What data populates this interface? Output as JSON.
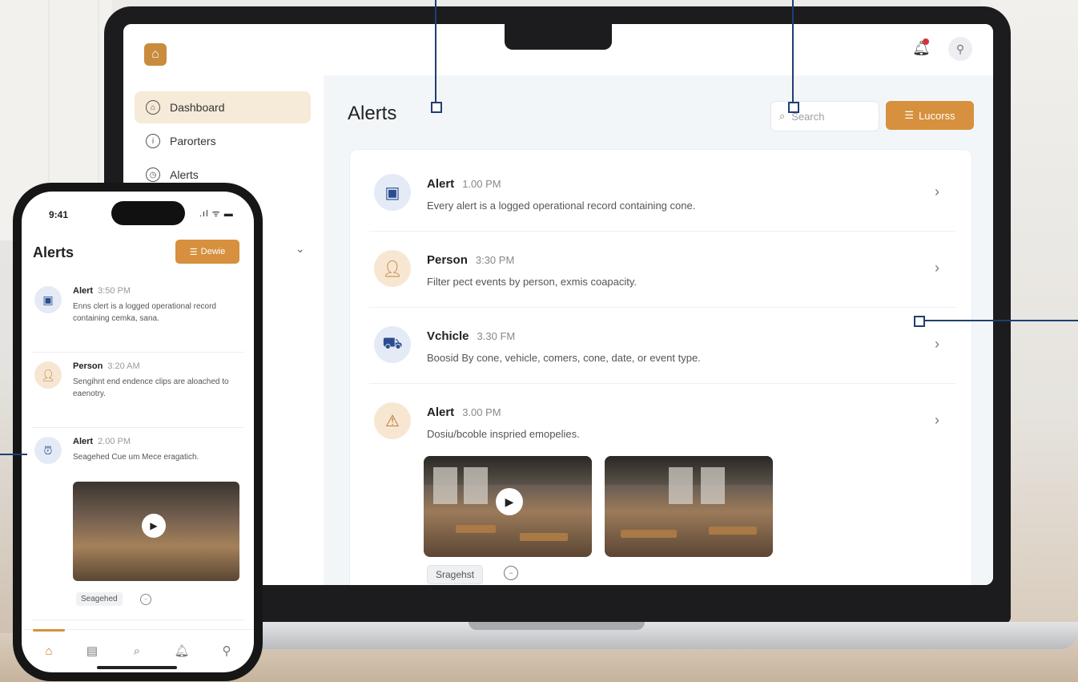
{
  "desktop": {
    "sidebar": {
      "logo_icon": "house-icon",
      "items": [
        {
          "label": "Dashboard",
          "icon": "home-icon",
          "active": true
        },
        {
          "label": "Parorters",
          "icon": "info-icon",
          "active": false
        },
        {
          "label": "Alerts",
          "icon": "clock-icon",
          "active": false
        }
      ]
    },
    "header": {
      "title": "Alerts",
      "search_placeholder": "Search",
      "filter_label": "Lucorss",
      "notification_dot_color": "#d2343a"
    },
    "alerts": [
      {
        "title": "Alert",
        "time": "1.00 PM",
        "desc": "Every alert is a logged operational record containing cone.",
        "icon": "video-camera-icon",
        "tone": "blue"
      },
      {
        "title": "Person",
        "time": "3:30 PM",
        "desc": "Filter pect events by person, exmis coapacity.",
        "icon": "person-icon",
        "tone": "peach"
      },
      {
        "title": "Vchicle",
        "time": "3.30 FM",
        "desc": "Boosid By cone, vehicle, comers, cone, date, or event type.",
        "icon": "car-icon",
        "tone": "blue"
      },
      {
        "title": "Alert",
        "time": "3.00 PM",
        "desc": "Dosiu/bcoble inspried emopelies.",
        "icon": "alarm-bell-icon",
        "tone": "peach"
      }
    ],
    "snapshot_tag": "Sragehst",
    "accent_color": "#d6903e"
  },
  "mobile": {
    "status_time": "9:41",
    "status_icons": ".ıl ᯤ ▬",
    "title": "Alerts",
    "button_label": "Dewie",
    "alerts": [
      {
        "title": "Alert",
        "time": "3:50 PM",
        "desc": "Enns clert is a logged operational record containing cemka, sana.",
        "icon": "video-camera-icon",
        "tone": "blue"
      },
      {
        "title": "Person",
        "time": "3:20 AM",
        "desc": "Sengihnt end endence clips are aloached to eaenotry.",
        "icon": "person-icon",
        "tone": "peach"
      },
      {
        "title": "Alert",
        "time": "2.00 PM",
        "desc": "Seagehed Cue um Mece eragatich.",
        "icon": "alarm-clock-icon",
        "tone": "blue"
      }
    ],
    "snapshot_tag": "Seagehed",
    "tabs": [
      "home-icon",
      "list-icon",
      "search-icon",
      "bell-icon",
      "user-icon"
    ]
  }
}
